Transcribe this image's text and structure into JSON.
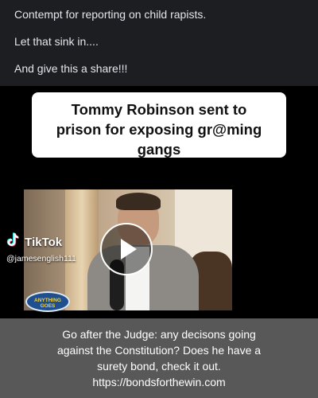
{
  "post": {
    "line1": "Contempt for reporting on child rapists.",
    "line2": "Let that sink in....",
    "line3": "And give this a share!!!"
  },
  "video": {
    "caption_line1": "Tommy Robinson sent to",
    "caption_line2": "prison for exposing gr@ming",
    "caption_line3": "gangs",
    "tiktok_label": "TikTok",
    "tiktok_handle": "@jamesenglish111",
    "show_logo": "ANYTHING GOES",
    "play_icon": "play-icon"
  },
  "overlay": {
    "line1": "Go after the Judge: any decisons going",
    "line2": "against the Constitution? Does he have a",
    "line3": "surety bond, check it out.",
    "line4": "https://bondsforthewin.com"
  }
}
